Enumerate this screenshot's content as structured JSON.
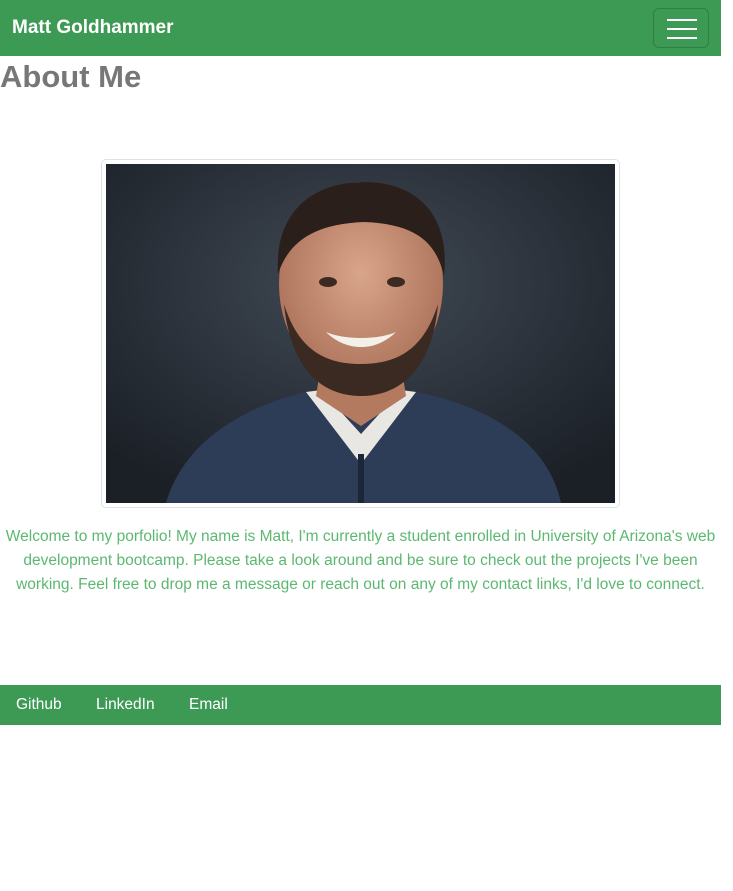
{
  "navbar": {
    "brand": "Matt Goldhammer",
    "toggle_icon": "hamburger-menu-icon"
  },
  "main": {
    "title": "About Me",
    "photo_alt": "Portrait of Matt Goldhammer",
    "intro": "Welcome to my porfolio! My name is Matt, I'm currently a student enrolled in University of Arizona's web development bootcamp. Please take a look around and be sure to check out the projects I've been working. Feel free to drop me a message or reach out on any of my contact links, I'd love to connect."
  },
  "footer": {
    "links": [
      {
        "label": "Github"
      },
      {
        "label": "LinkedIn"
      },
      {
        "label": "Email"
      }
    ]
  },
  "colors": {
    "nav_green": "#3d9a55",
    "text_green": "#5cb870",
    "title_gray": "#777777"
  }
}
